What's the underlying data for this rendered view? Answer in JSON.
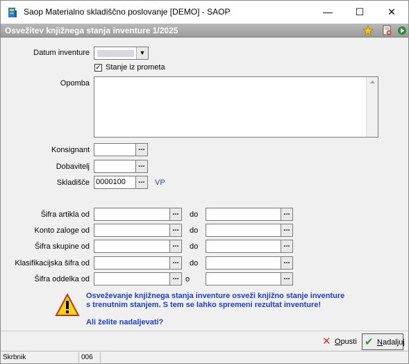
{
  "window": {
    "title": "Saop Materialno skladiščno poslovanje [DEMO] - SAOP",
    "minimize_glyph": "—",
    "maximize_glyph": "☐",
    "close_glyph": "✕"
  },
  "header": {
    "title": "Osvežitev knjižnega stanja inventure 1/2025",
    "icons": [
      "star-icon",
      "document-close-icon",
      "run-icon"
    ]
  },
  "form": {
    "datum_label": "Datum inventure",
    "datum_value": "",
    "stanje_label": "Stanje iz prometa",
    "stanje_checked": true,
    "opomba_label": "Opomba",
    "opomba_value": "",
    "konsignant_label": "Konsignant",
    "konsignant_value": "",
    "dobavitelj_label": "Dobavitelj",
    "dobavitelj_value": "",
    "skladisce_label": "Skladišče",
    "skladisce_value": "0000100",
    "skladisce_code": "VP",
    "lookup_glyph": "..."
  },
  "ranges": [
    {
      "label": "Šifra artikla od",
      "to": "do",
      "from_value": "",
      "to_value": ""
    },
    {
      "label": "Konto zaloge od",
      "to": "do",
      "from_value": "",
      "to_value": ""
    },
    {
      "label": "Šifra skupine od",
      "to": "do",
      "from_value": "",
      "to_value": ""
    },
    {
      "label": "Klasifikacijska šifra od",
      "to": "do",
      "from_value": "",
      "to_value": ""
    },
    {
      "label": "Šifra oddelka od",
      "to": "o",
      "from_value": "",
      "to_value": ""
    }
  ],
  "message": {
    "line1": "Osveževanje knjižnega stanja inventure osveži knjižno stanje inventure",
    "line2": "s trenutnim stanjem. S tem se lahko spremeni rezultat inventure!",
    "question": "Ali želite nadaljevati?"
  },
  "buttons": {
    "cancel_label": "Opusti",
    "ok_label": "Nadaljuj"
  },
  "status": {
    "user": "Skrbnik",
    "code": "006"
  },
  "colors": {
    "message_blue": "#1c3fc4",
    "header_gray": "#a8a8a8"
  }
}
